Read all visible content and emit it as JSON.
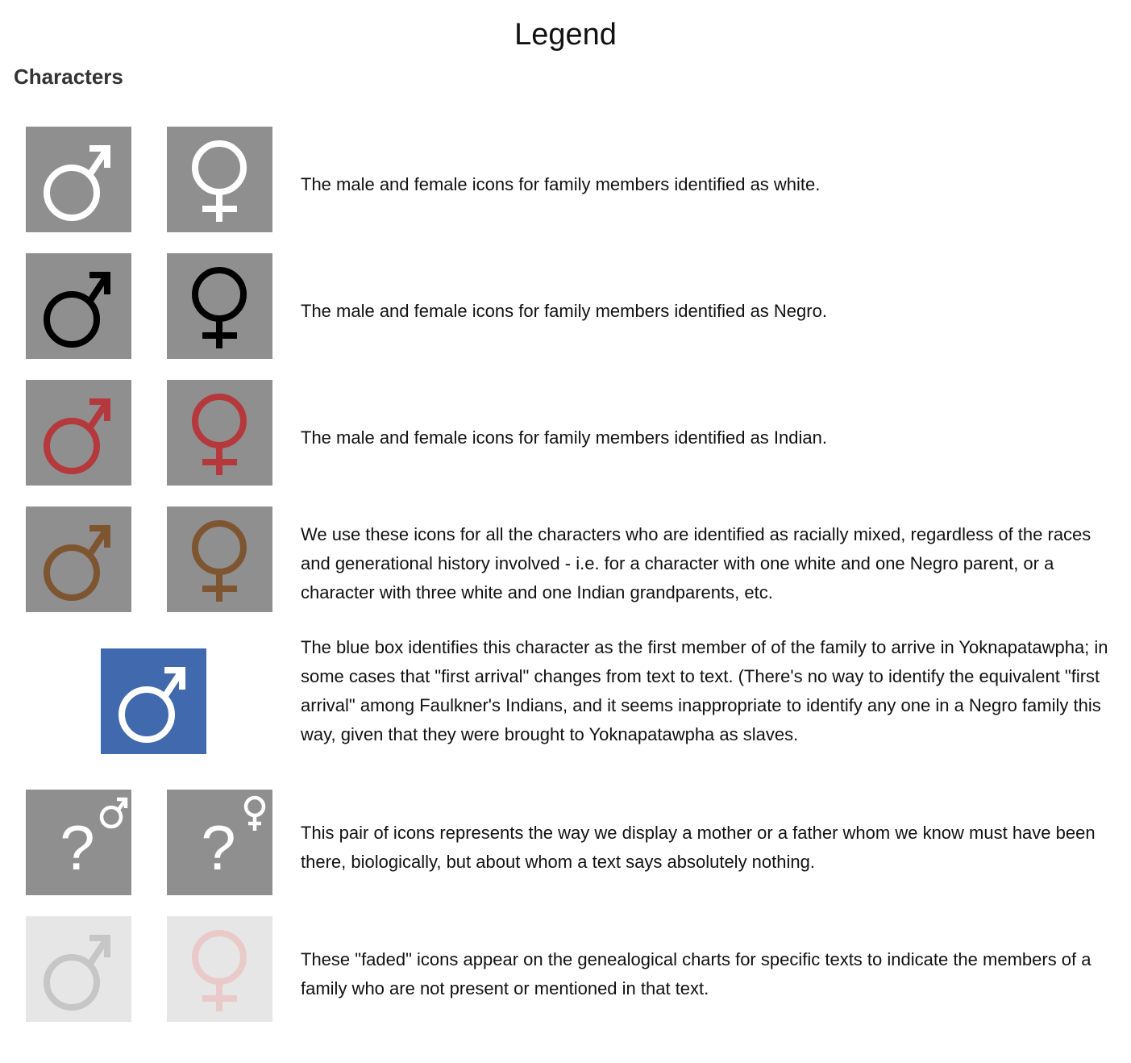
{
  "title": "Legend",
  "section_heading": "Characters",
  "colors": {
    "box_gray": "#8f8f8f",
    "box_faded": "#e6e6e6",
    "box_blue": "#4169ae",
    "white_symbol": "#ffffff",
    "negro_symbol": "#000000",
    "indian_symbol": "#b5383c",
    "mixed_symbol": "#7e5531",
    "faded_male_symbol": "#c6c6c6",
    "faded_female_symbol": "#eac9c9"
  },
  "rows": [
    {
      "icons": [
        "male-symbol-icon",
        "female-symbol-icon"
      ],
      "description": "The male and female icons for family members identified as white."
    },
    {
      "icons": [
        "male-symbol-icon",
        "female-symbol-icon"
      ],
      "description": "The male and female icons for family members identified as Negro."
    },
    {
      "icons": [
        "male-symbol-icon",
        "female-symbol-icon"
      ],
      "description": "The male and female icons for family members identified as Indian."
    },
    {
      "icons": [
        "male-symbol-icon",
        "female-symbol-icon"
      ],
      "description": "We use these icons for all the characters who are identified as racially mixed, regardless of the races and generational history involved - i.e. for a character with one white and one Negro parent, or a character with three white and one Indian grandparents, etc."
    },
    {
      "icons": [
        "male-symbol-icon"
      ],
      "description": "The blue box identifies this character as the first member of of the family to arrive in Yoknapatawpha; in some cases that \"first arrival\" changes from text to text. (There's no way to identify the equivalent \"first arrival\" among Faulkner's Indians, and it seems inappropriate to identify any one in a Negro family this way, given that they were brought to Yoknapatawpha as slaves."
    },
    {
      "icons": [
        "question-male-icon",
        "question-female-icon"
      ],
      "unknown_mark": "?",
      "description": "This pair of icons represents the way we display a mother or a father whom we know must have been there, biologically, but about whom a text says absolutely nothing."
    },
    {
      "icons": [
        "male-symbol-icon",
        "female-symbol-icon"
      ],
      "description": "These \"faded\" icons appear on the genealogical charts for specific texts to indicate the members of a family who are not present or mentioned in that text."
    }
  ]
}
